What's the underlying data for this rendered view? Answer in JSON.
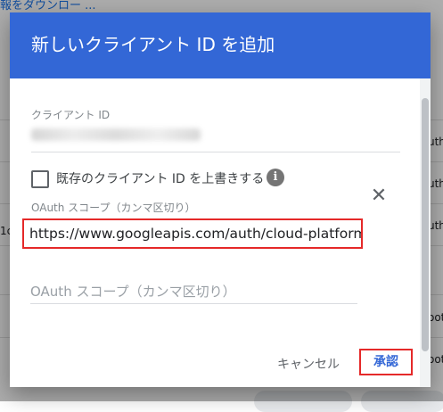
{
  "background": {
    "top_link": "報をダウンロー ...",
    "right_snippets": [
      "uth",
      "uth",
      "uth",
      "oot",
      "oot"
    ],
    "left_snippet": "1c"
  },
  "dialog": {
    "title": "新しいクライアント ID を追加",
    "client_id_label": "クライアント ID",
    "overwrite_checkbox_label": "既存のクライアント ID を上書きする",
    "info_icon_glyph": "i",
    "scope_label": "OAuth スコープ（カンマ区切り）",
    "scope_value": "https://www.googleapis.com/auth/cloud-platform",
    "scope_placeholder": "OAuth スコープ（カンマ区切り）",
    "close_glyph": "✕",
    "cancel_label": "キャンセル",
    "approve_label": "承認"
  },
  "colors": {
    "header": "#3367d6",
    "highlight_border": "#e52929",
    "primary_text_button": "#3367d6"
  }
}
